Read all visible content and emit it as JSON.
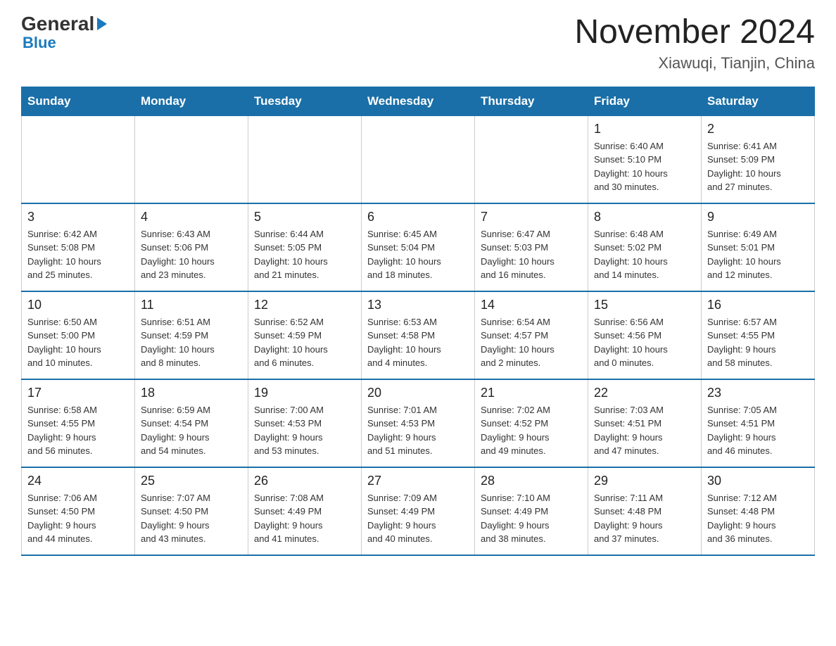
{
  "header": {
    "logo_general": "General",
    "logo_blue": "Blue",
    "title": "November 2024",
    "subtitle": "Xiawuqi, Tianjin, China"
  },
  "days_of_week": [
    "Sunday",
    "Monday",
    "Tuesday",
    "Wednesday",
    "Thursday",
    "Friday",
    "Saturday"
  ],
  "weeks": [
    {
      "days": [
        {
          "number": "",
          "info": ""
        },
        {
          "number": "",
          "info": ""
        },
        {
          "number": "",
          "info": ""
        },
        {
          "number": "",
          "info": ""
        },
        {
          "number": "",
          "info": ""
        },
        {
          "number": "1",
          "info": "Sunrise: 6:40 AM\nSunset: 5:10 PM\nDaylight: 10 hours\nand 30 minutes."
        },
        {
          "number": "2",
          "info": "Sunrise: 6:41 AM\nSunset: 5:09 PM\nDaylight: 10 hours\nand 27 minutes."
        }
      ]
    },
    {
      "days": [
        {
          "number": "3",
          "info": "Sunrise: 6:42 AM\nSunset: 5:08 PM\nDaylight: 10 hours\nand 25 minutes."
        },
        {
          "number": "4",
          "info": "Sunrise: 6:43 AM\nSunset: 5:06 PM\nDaylight: 10 hours\nand 23 minutes."
        },
        {
          "number": "5",
          "info": "Sunrise: 6:44 AM\nSunset: 5:05 PM\nDaylight: 10 hours\nand 21 minutes."
        },
        {
          "number": "6",
          "info": "Sunrise: 6:45 AM\nSunset: 5:04 PM\nDaylight: 10 hours\nand 18 minutes."
        },
        {
          "number": "7",
          "info": "Sunrise: 6:47 AM\nSunset: 5:03 PM\nDaylight: 10 hours\nand 16 minutes."
        },
        {
          "number": "8",
          "info": "Sunrise: 6:48 AM\nSunset: 5:02 PM\nDaylight: 10 hours\nand 14 minutes."
        },
        {
          "number": "9",
          "info": "Sunrise: 6:49 AM\nSunset: 5:01 PM\nDaylight: 10 hours\nand 12 minutes."
        }
      ]
    },
    {
      "days": [
        {
          "number": "10",
          "info": "Sunrise: 6:50 AM\nSunset: 5:00 PM\nDaylight: 10 hours\nand 10 minutes."
        },
        {
          "number": "11",
          "info": "Sunrise: 6:51 AM\nSunset: 4:59 PM\nDaylight: 10 hours\nand 8 minutes."
        },
        {
          "number": "12",
          "info": "Sunrise: 6:52 AM\nSunset: 4:59 PM\nDaylight: 10 hours\nand 6 minutes."
        },
        {
          "number": "13",
          "info": "Sunrise: 6:53 AM\nSunset: 4:58 PM\nDaylight: 10 hours\nand 4 minutes."
        },
        {
          "number": "14",
          "info": "Sunrise: 6:54 AM\nSunset: 4:57 PM\nDaylight: 10 hours\nand 2 minutes."
        },
        {
          "number": "15",
          "info": "Sunrise: 6:56 AM\nSunset: 4:56 PM\nDaylight: 10 hours\nand 0 minutes."
        },
        {
          "number": "16",
          "info": "Sunrise: 6:57 AM\nSunset: 4:55 PM\nDaylight: 9 hours\nand 58 minutes."
        }
      ]
    },
    {
      "days": [
        {
          "number": "17",
          "info": "Sunrise: 6:58 AM\nSunset: 4:55 PM\nDaylight: 9 hours\nand 56 minutes."
        },
        {
          "number": "18",
          "info": "Sunrise: 6:59 AM\nSunset: 4:54 PM\nDaylight: 9 hours\nand 54 minutes."
        },
        {
          "number": "19",
          "info": "Sunrise: 7:00 AM\nSunset: 4:53 PM\nDaylight: 9 hours\nand 53 minutes."
        },
        {
          "number": "20",
          "info": "Sunrise: 7:01 AM\nSunset: 4:53 PM\nDaylight: 9 hours\nand 51 minutes."
        },
        {
          "number": "21",
          "info": "Sunrise: 7:02 AM\nSunset: 4:52 PM\nDaylight: 9 hours\nand 49 minutes."
        },
        {
          "number": "22",
          "info": "Sunrise: 7:03 AM\nSunset: 4:51 PM\nDaylight: 9 hours\nand 47 minutes."
        },
        {
          "number": "23",
          "info": "Sunrise: 7:05 AM\nSunset: 4:51 PM\nDaylight: 9 hours\nand 46 minutes."
        }
      ]
    },
    {
      "days": [
        {
          "number": "24",
          "info": "Sunrise: 7:06 AM\nSunset: 4:50 PM\nDaylight: 9 hours\nand 44 minutes."
        },
        {
          "number": "25",
          "info": "Sunrise: 7:07 AM\nSunset: 4:50 PM\nDaylight: 9 hours\nand 43 minutes."
        },
        {
          "number": "26",
          "info": "Sunrise: 7:08 AM\nSunset: 4:49 PM\nDaylight: 9 hours\nand 41 minutes."
        },
        {
          "number": "27",
          "info": "Sunrise: 7:09 AM\nSunset: 4:49 PM\nDaylight: 9 hours\nand 40 minutes."
        },
        {
          "number": "28",
          "info": "Sunrise: 7:10 AM\nSunset: 4:49 PM\nDaylight: 9 hours\nand 38 minutes."
        },
        {
          "number": "29",
          "info": "Sunrise: 7:11 AM\nSunset: 4:48 PM\nDaylight: 9 hours\nand 37 minutes."
        },
        {
          "number": "30",
          "info": "Sunrise: 7:12 AM\nSunset: 4:48 PM\nDaylight: 9 hours\nand 36 minutes."
        }
      ]
    }
  ]
}
